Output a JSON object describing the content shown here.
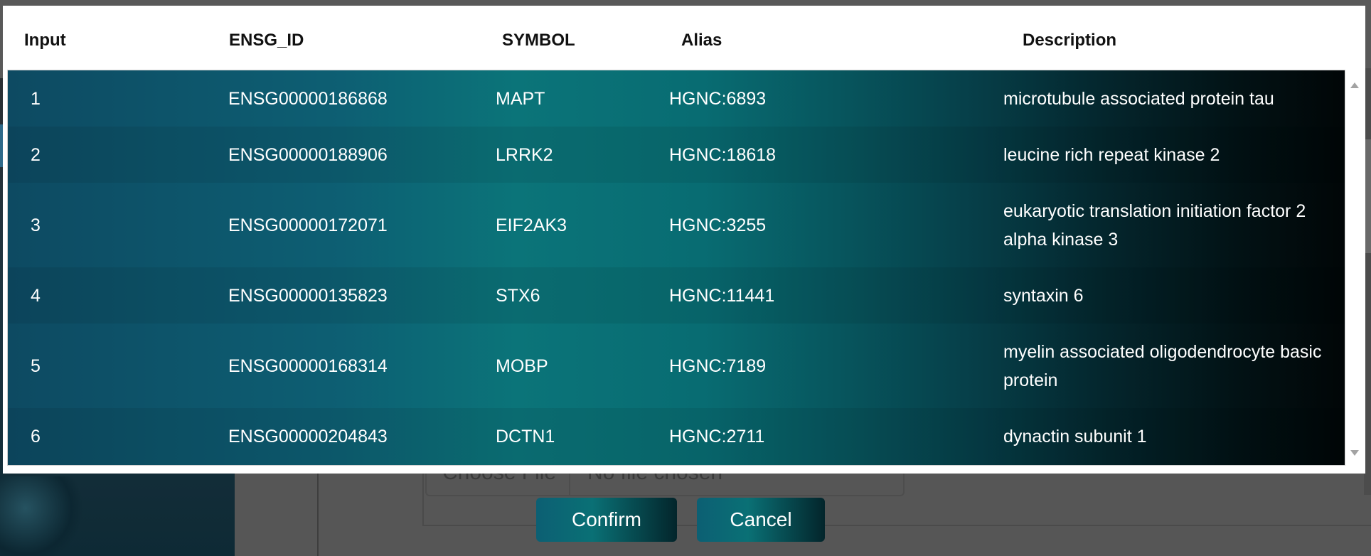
{
  "background": {
    "file_input": {
      "button_label": "Choose File",
      "status": "No file chosen"
    }
  },
  "dialog": {
    "columns": [
      "Input",
      "ENSG_ID",
      "SYMBOL",
      "Alias",
      "Description"
    ],
    "rows": [
      {
        "input": "1",
        "ensg_id": "ENSG00000186868",
        "symbol": "MAPT",
        "alias": "HGNC:6893",
        "description": "microtubule associated protein tau"
      },
      {
        "input": "2",
        "ensg_id": "ENSG00000188906",
        "symbol": "LRRK2",
        "alias": "HGNC:18618",
        "description": "leucine rich repeat kinase 2"
      },
      {
        "input": "3",
        "ensg_id": "ENSG00000172071",
        "symbol": "EIF2AK3",
        "alias": "HGNC:3255",
        "description": "eukaryotic translation initiation factor 2 alpha kinase 3"
      },
      {
        "input": "4",
        "ensg_id": "ENSG00000135823",
        "symbol": "STX6",
        "alias": "HGNC:11441",
        "description": "syntaxin 6"
      },
      {
        "input": "5",
        "ensg_id": "ENSG00000168314",
        "symbol": "MOBP",
        "alias": "HGNC:7189",
        "description": "myelin associated oligodendrocyte basic protein"
      },
      {
        "input": "6",
        "ensg_id": "ENSG00000204843",
        "symbol": "DCTN1",
        "alias": "HGNC:2711",
        "description": "dynactin subunit 1"
      }
    ],
    "buttons": {
      "confirm": "Confirm",
      "cancel": "Cancel"
    }
  },
  "colors": {
    "header_bg": "#ffffff",
    "table_gradient_start": "#0d4a62",
    "table_gradient_mid": "#0b7479",
    "table_gradient_end": "#010607",
    "text_on_table": "#ffffff"
  }
}
